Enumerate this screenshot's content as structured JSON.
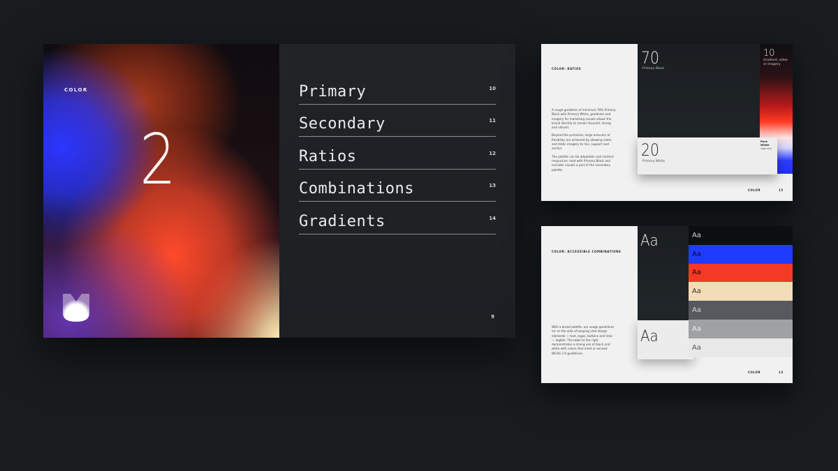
{
  "spread": {
    "section_label": "COLOR",
    "big_number": "2",
    "toc": [
      {
        "title": "Primary",
        "page": "10"
      },
      {
        "title": "Secondary",
        "page": "11"
      },
      {
        "title": "Ratios",
        "page": "12"
      },
      {
        "title": "Combinations",
        "page": "13"
      },
      {
        "title": "Gradients",
        "page": "14"
      }
    ],
    "page_number": "9"
  },
  "ratios_page": {
    "label": "COLOR: RATIOS",
    "body": [
      "A rough guideline of minimum 70% Primary Black with Primary White, gradients and imagery for marketing visuals allows the brand identity to remain focused, strong and vibrant.",
      "Beyond the primaries, large amounts of flexibility are achieved by allowing video and static imagery to mix, support and anchor.",
      "The palette can be adaptable and content-responsive: lead with Primary Black and consider visuals a part of the secondary palette."
    ],
    "seventy": {
      "number": "70",
      "label": "Primary Black"
    },
    "ten": {
      "number": "10",
      "label": "Gradient, video or imagery"
    },
    "twenty": {
      "number": "20",
      "label": "Primary White"
    },
    "pure_white": "Pure White",
    "logo_only": "Logo only",
    "footer_label": "COLOR",
    "footer_page": "15"
  },
  "combos_page": {
    "label": "COLOR: ACCESSIBLE COMBINATIONS",
    "body": [
      "With a broad palette, our usage guidelines err on the side of keeping vital design elements — text, logos, buttons and links — legible. The table to the right demonstrates a strong use of black and white with colors that meet or exceed WCAG 2.0 guidelines."
    ],
    "aa_dark": "Aa",
    "aa_light": "Aa",
    "swatches": [
      {
        "text": "Aa",
        "bg": "#0d0e10",
        "fg": "#d8d8d8"
      },
      {
        "text": "Aa",
        "bg": "#1f3bff",
        "fg": "#0b0b14"
      },
      {
        "text": "Aa",
        "bg": "#f23a24",
        "fg": "#1a0a08"
      },
      {
        "text": "Aa",
        "bg": "#f2ddb8",
        "fg": "#3a3326"
      },
      {
        "text": "Aa",
        "bg": "#565a5e",
        "fg": "#d4d6d8"
      },
      {
        "text": "Aa",
        "bg": "#9fa2a4",
        "fg": "#eeeeee"
      },
      {
        "text": "Aa",
        "bg": "#e8e8e8",
        "fg": "#555555"
      }
    ],
    "footer_label": "COLOR",
    "footer_page": "13"
  }
}
